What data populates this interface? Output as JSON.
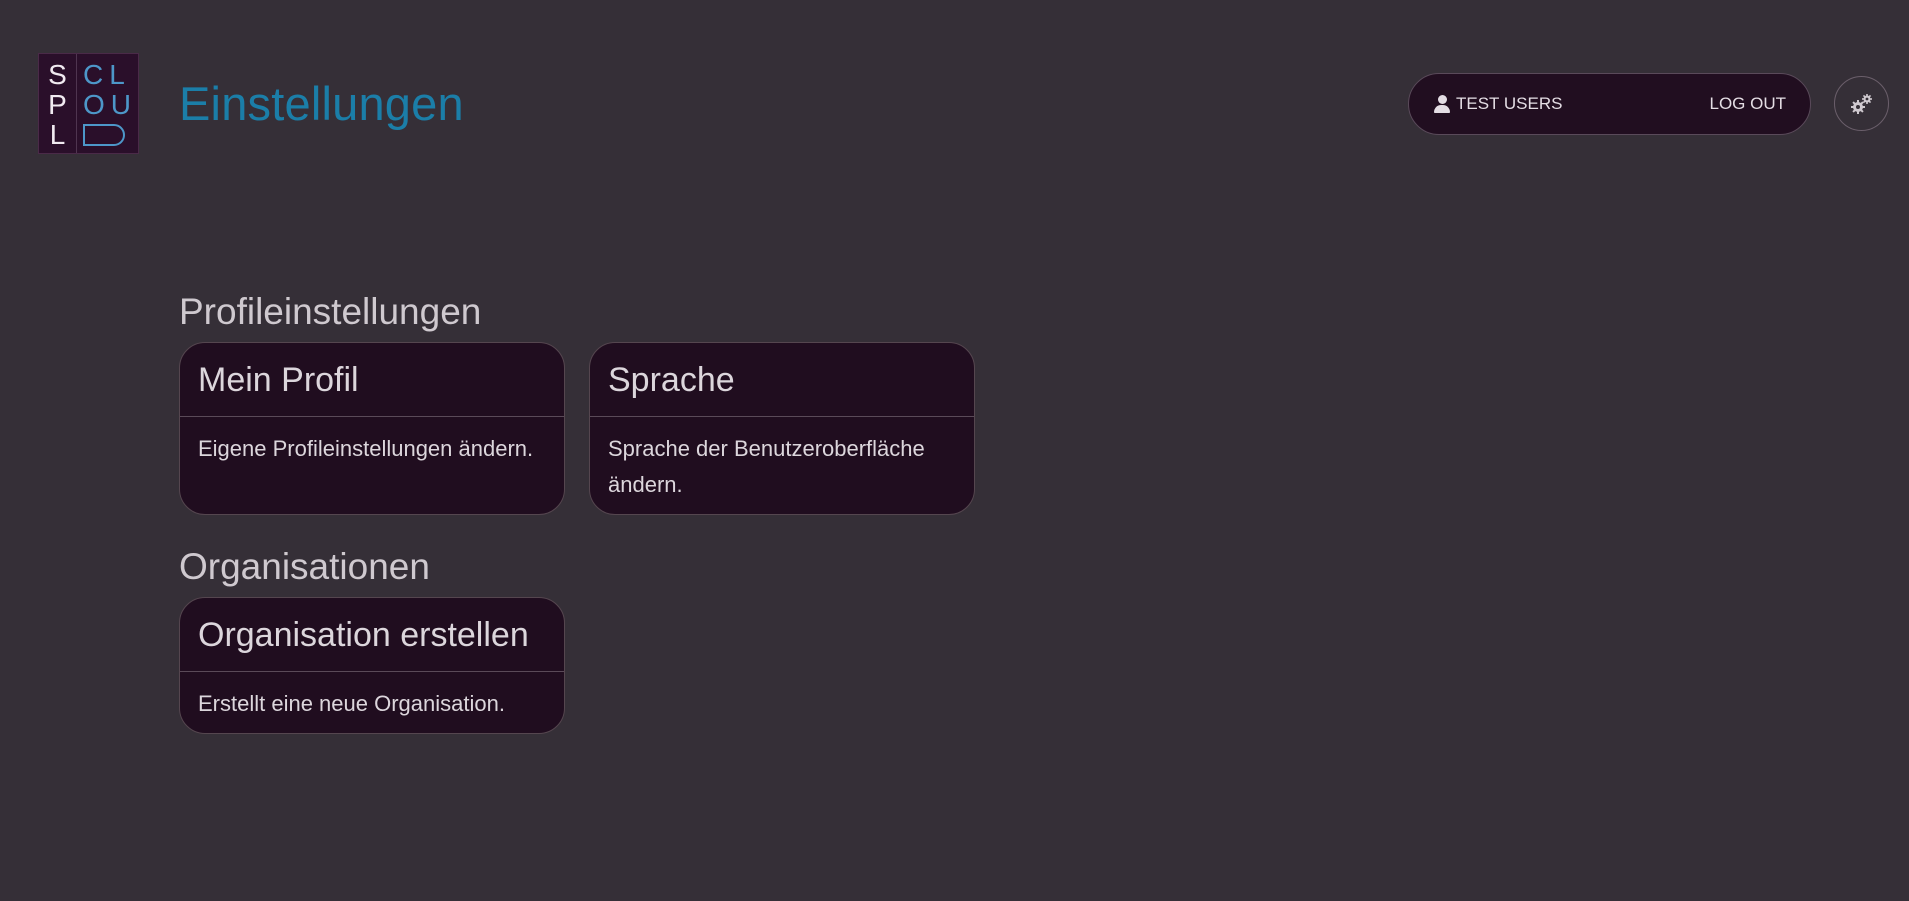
{
  "logo": {
    "left_letters": [
      "S",
      "P",
      "L"
    ],
    "right_letters": [
      "CL",
      "OU"
    ]
  },
  "header": {
    "title": "Einstellungen",
    "user_name": "TEST USERS",
    "logout_label": "LOG OUT",
    "settings_icon": "gears-icon"
  },
  "sections": [
    {
      "title": "Profileinstellungen",
      "cards": [
        {
          "title": "Mein Profil",
          "description": "Eigene Profileinstellungen ändern."
        },
        {
          "title": "Sprache",
          "description": "Sprache der Benutzeroberfläche ändern."
        }
      ]
    },
    {
      "title": "Organisationen",
      "cards": [
        {
          "title": "Organisation erstellen",
          "description": "Erstellt eine neue Organisation."
        }
      ]
    }
  ],
  "colors": {
    "background": "#352f37",
    "card": "#200d1f",
    "accent": "#1b7ea8",
    "logo_blue": "#4d97c9"
  }
}
